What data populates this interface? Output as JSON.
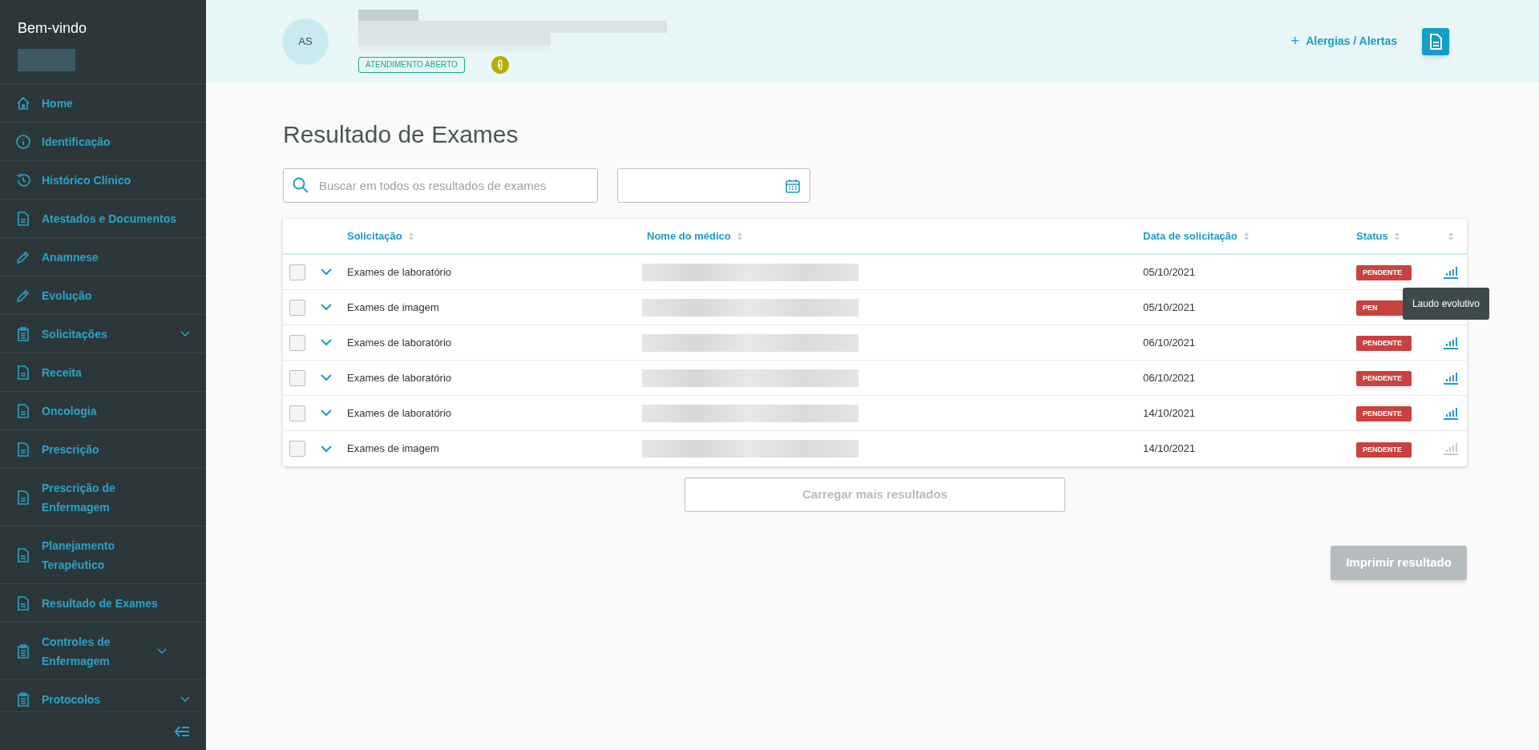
{
  "sidebar": {
    "greeting": "Bem-vindo",
    "items": [
      {
        "label": "Home",
        "kind": "home",
        "expandable": false
      },
      {
        "label": "Identificação",
        "kind": "info",
        "expandable": false
      },
      {
        "label": "Histórico Clínico",
        "kind": "history",
        "expandable": false
      },
      {
        "label": "Atestados e Documentos",
        "kind": "document",
        "expandable": false
      },
      {
        "label": "Anamnese",
        "kind": "pencil",
        "expandable": false
      },
      {
        "label": "Evolução",
        "kind": "pencil",
        "expandable": false
      },
      {
        "label": "Solicitações",
        "kind": "clipboard",
        "expandable": true
      },
      {
        "label": "Receita",
        "kind": "document",
        "expandable": false
      },
      {
        "label": "Oncologia",
        "kind": "document",
        "expandable": false
      },
      {
        "label": "Prescrição",
        "kind": "document",
        "expandable": false
      },
      {
        "label": "Prescrição de Enfermagem",
        "kind": "document",
        "expandable": false
      },
      {
        "label": "Planejamento Terapêutico",
        "kind": "document",
        "expandable": false
      },
      {
        "label": "Resultado de Exames",
        "kind": "document",
        "expandable": false
      },
      {
        "label": "Controles de Enfermagem",
        "kind": "clipboard",
        "expandable": true
      },
      {
        "label": "Protocolos",
        "kind": "clipboard",
        "expandable": true
      }
    ]
  },
  "patient": {
    "initials": "AS",
    "status_badge": "ATENDIMENTO ABERTO"
  },
  "header_actions": {
    "alerts_link": "Alergias / Alertas",
    "plus": "+"
  },
  "page_title": "Resultado de Exames",
  "search": {
    "placeholder": "Buscar em todos os resultados de exames"
  },
  "table": {
    "columns": [
      "Solicitação",
      "Nome do médico",
      "Data de solicitação",
      "Status"
    ],
    "rows": [
      {
        "checked": false,
        "request": "Exames de laboratório",
        "date": "05/10/2021",
        "status": "PENDENTE",
        "chart_disabled": false
      },
      {
        "checked": false,
        "request": "Exames de imagem",
        "date": "05/10/2021",
        "status": "PEN"
      },
      {
        "checked": false,
        "request": "Exames de laboratório",
        "date": "06/10/2021",
        "status": "PENDENTE",
        "chart_disabled": false
      },
      {
        "checked": false,
        "request": "Exames de laboratório",
        "date": "06/10/2021",
        "status": "PENDENTE",
        "chart_disabled": false
      },
      {
        "checked": false,
        "request": "Exames de laboratório",
        "date": "14/10/2021",
        "status": "PENDENTE",
        "chart_disabled": false
      },
      {
        "checked": false,
        "request": "Exames de imagem",
        "date": "14/10/2021",
        "status": "PENDENTE",
        "chart_disabled": true
      }
    ]
  },
  "tooltip": "Laudo evolutivo",
  "load_more": {
    "label": "Carregar mais resultados",
    "disabled": true
  },
  "print": {
    "label": "Imprimir resultado",
    "disabled": true
  }
}
